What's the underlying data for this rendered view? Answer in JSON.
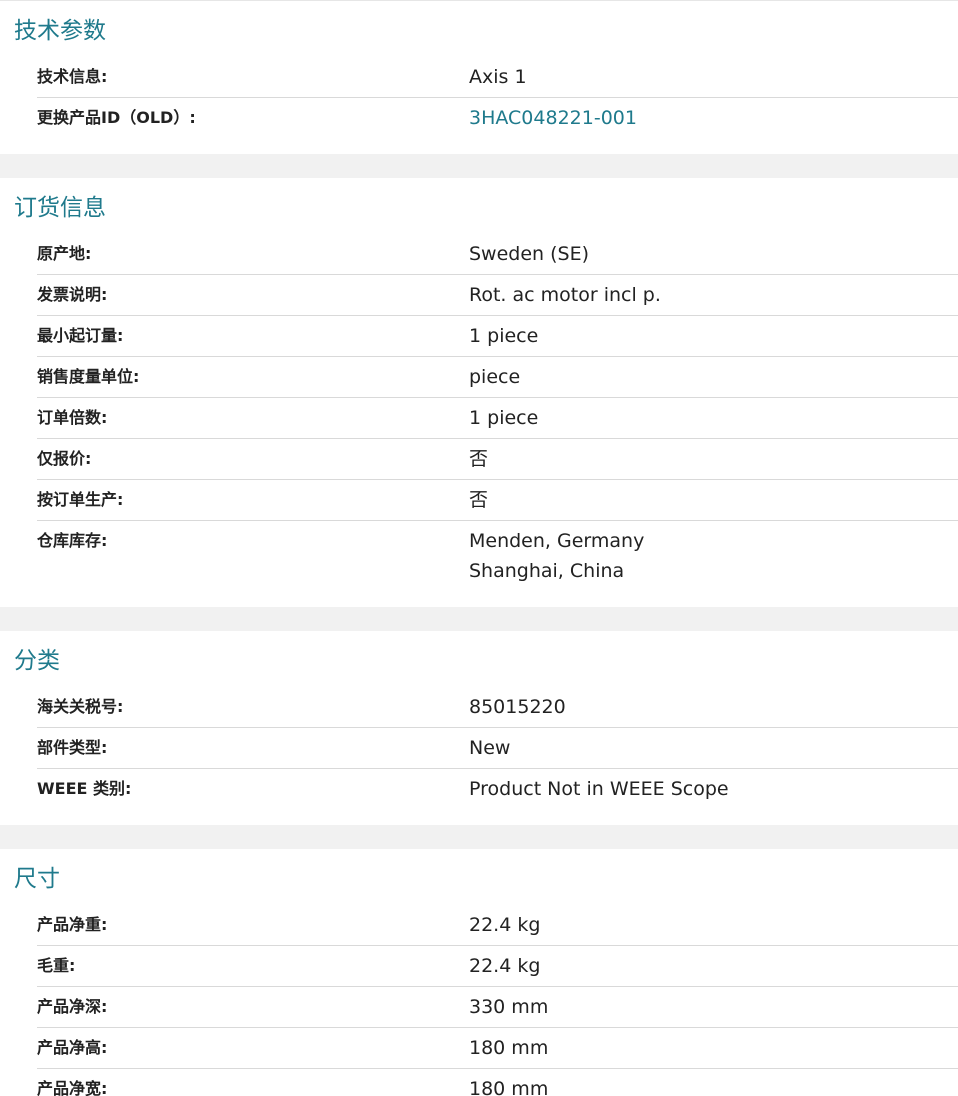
{
  "sections": {
    "tech": {
      "title": "技术参数",
      "rows": [
        {
          "label": "技术信息:",
          "value": "Axis 1"
        },
        {
          "label": "更换产品ID（OLD）:",
          "value": "3HAC048221-001"
        }
      ]
    },
    "order": {
      "title": "订货信息",
      "rows": [
        {
          "label": "原产地:",
          "value": "Sweden (SE)"
        },
        {
          "label": "发票说明:",
          "value": "Rot. ac motor incl p."
        },
        {
          "label": "最小起订量:",
          "value": "1 piece"
        },
        {
          "label": "销售度量单位:",
          "value": "piece"
        },
        {
          "label": "订单倍数:",
          "value": "1 piece"
        },
        {
          "label": "仅报价:",
          "value": "否"
        },
        {
          "label": "按订单生产:",
          "value": "否"
        },
        {
          "label": "仓库库存:",
          "values": [
            "Menden, Germany",
            "Shanghai, China"
          ]
        }
      ]
    },
    "classification": {
      "title": "分类",
      "rows": [
        {
          "label": "海关关税号:",
          "value": "85015220"
        },
        {
          "label": "部件类型:",
          "value": "New"
        },
        {
          "label": "WEEE 类别:",
          "value": "Product Not in WEEE Scope"
        }
      ]
    },
    "dimensions": {
      "title": "尺寸",
      "rows": [
        {
          "label": "产品净重:",
          "value": "22.4 kg"
        },
        {
          "label": "毛重:",
          "value": "22.4 kg"
        },
        {
          "label": "产品净深:",
          "value": "330 mm"
        },
        {
          "label": "产品净高:",
          "value": "180 mm"
        },
        {
          "label": "产品净宽:",
          "value": "180 mm"
        }
      ]
    }
  },
  "colors": {
    "title_teal": "#1f7a8c",
    "link_teal": "#1f7a8c",
    "divider": "#d9d9d9",
    "band": "#f1f1f1"
  }
}
